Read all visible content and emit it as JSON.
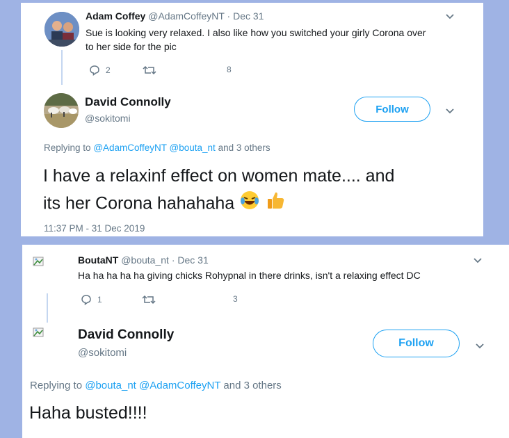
{
  "tweet1": {
    "name": "Adam Coffey",
    "handle": "@AdamCoffeyNT",
    "sep_date": "· Dec 31",
    "text_line1": "Sue is looking very relaxed. I also like how you switched your girly Corona over",
    "text_line2": "to her side for the pic",
    "reply_count": "2",
    "like_count": "8"
  },
  "tweet2": {
    "name": "David Connolly",
    "handle": "@sokitomi",
    "follow_label": "Follow",
    "replying_prefix": "Replying to",
    "replying_mentions": "@AdamCoffeyNT @bouta_nt",
    "replying_suffix": "and 3 others",
    "text_line1": "I have a relaxinf effect on women mate.... and",
    "text_line2": "its her Corona hahahaha",
    "timestamp": "11:37 PM - 31 Dec 2019"
  },
  "tweet3": {
    "name": "BoutaNT",
    "handle": "@bouta_nt",
    "sep_date": "· Dec 31",
    "text": "Ha ha ha ha ha giving chicks Rohypnal in there drinks, isn't a relaxing effect DC",
    "reply_count": "1",
    "like_count": "3"
  },
  "tweet4": {
    "name": "David Connolly",
    "handle": "@sokitomi",
    "follow_label": "Follow",
    "replying_prefix": "Replying to",
    "replying_mentions": "@bouta_nt @AdamCoffeyNT",
    "replying_suffix": "and 3 others",
    "text": "Haha busted!!!!"
  },
  "colors": {
    "accent": "#1da1f2",
    "muted": "#657786",
    "frame": "#9fb3e4"
  },
  "icons": [
    "reply-icon",
    "retweet-icon",
    "chevron-down-icon",
    "broken-image-icon",
    "laughing-emoji-icon",
    "thumbs-up-emoji-icon"
  ]
}
